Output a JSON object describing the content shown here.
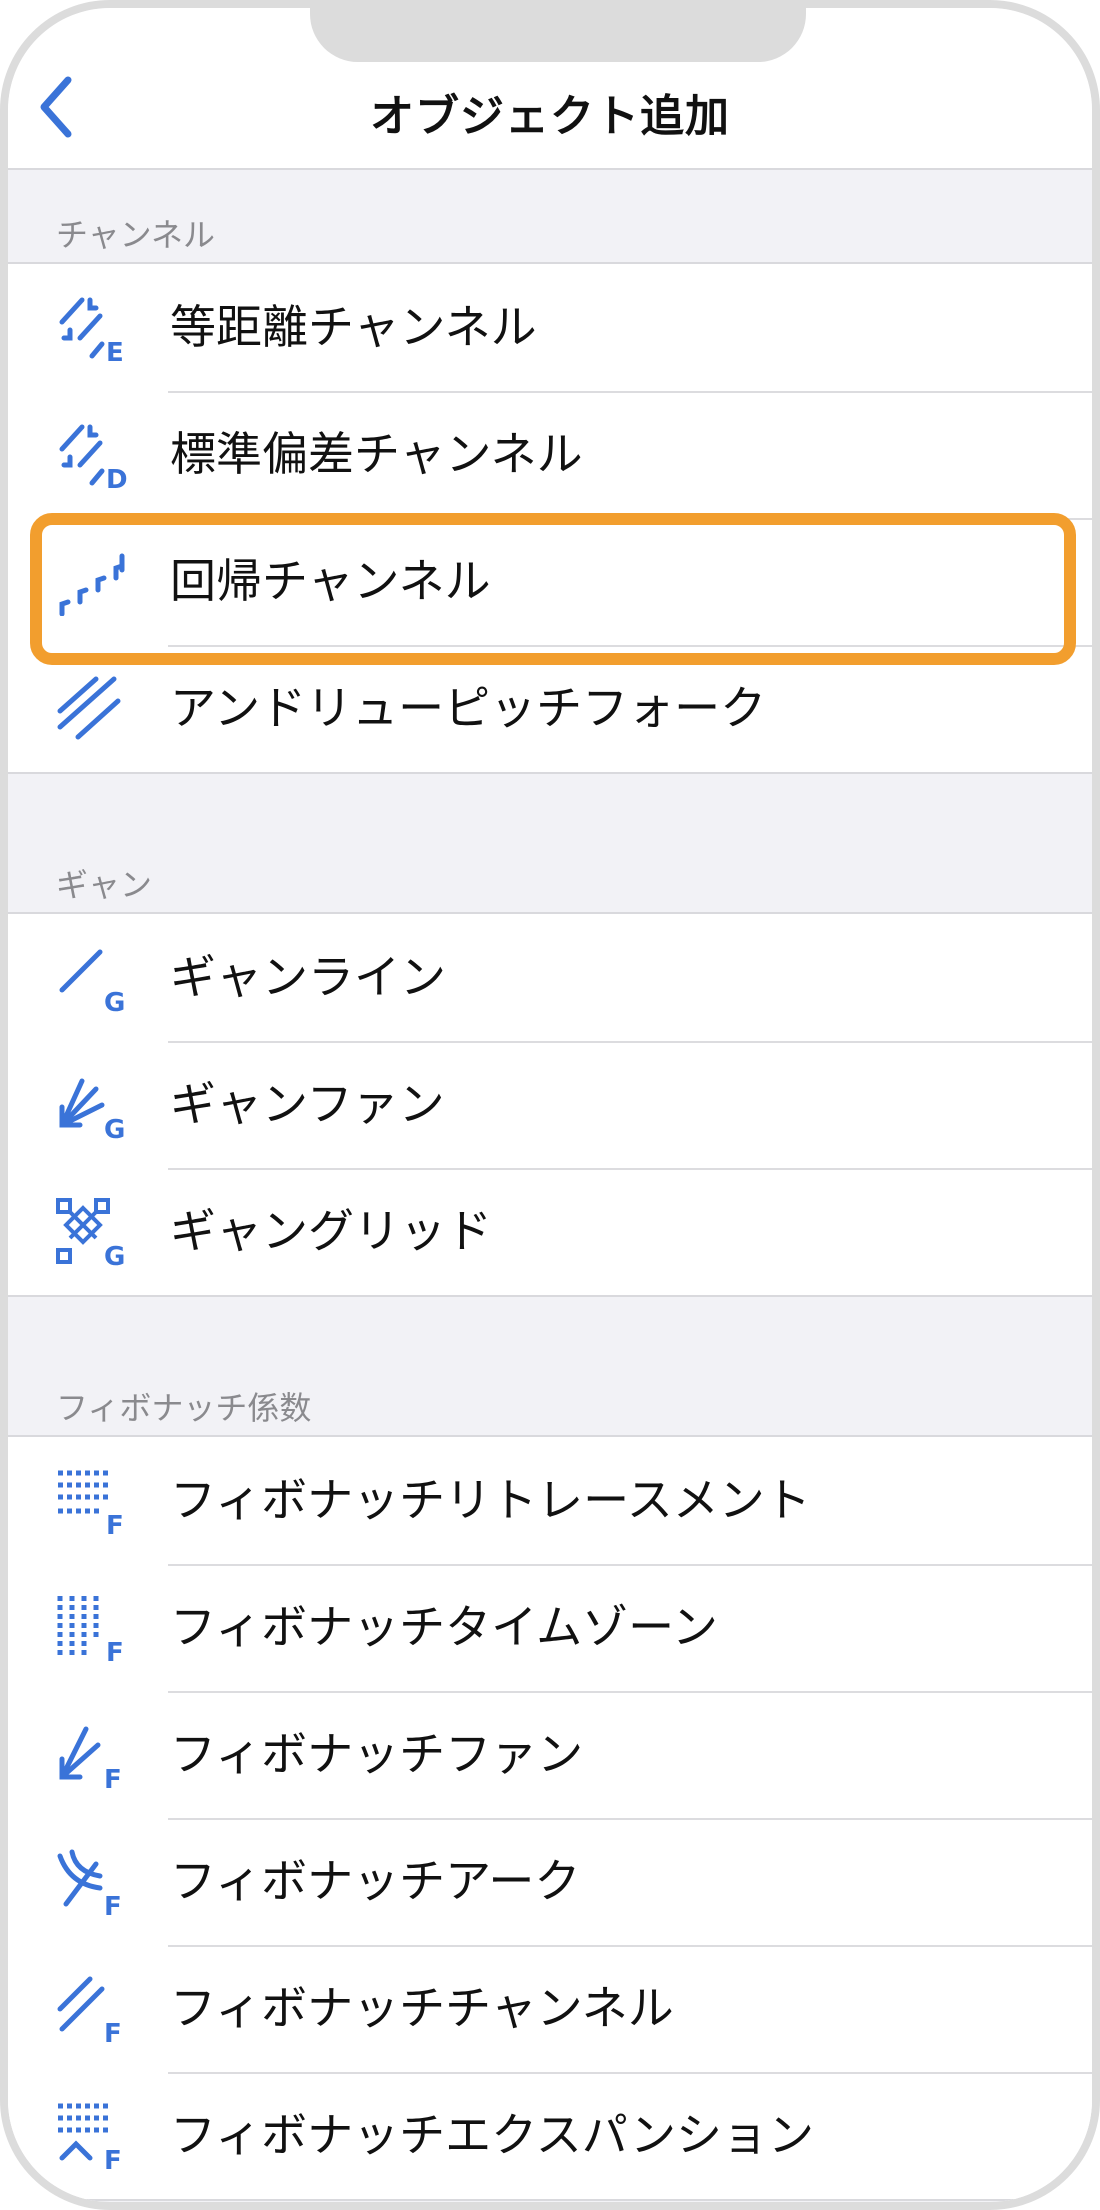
{
  "nav": {
    "title": "オブジェクト追加"
  },
  "sections": [
    {
      "header": "チャンネル",
      "items": [
        {
          "label": "等距離チャンネル",
          "icon": "equidistant-channel-icon"
        },
        {
          "label": "標準偏差チャンネル",
          "icon": "std-deviation-channel-icon"
        },
        {
          "label": "回帰チャンネル",
          "icon": "regression-channel-icon"
        },
        {
          "label": "アンドリューピッチフォーク",
          "icon": "andrews-pitchfork-icon"
        }
      ]
    },
    {
      "header": "ギャン",
      "items": [
        {
          "label": "ギャンライン",
          "icon": "gann-line-icon"
        },
        {
          "label": "ギャンファン",
          "icon": "gann-fan-icon"
        },
        {
          "label": "ギャングリッド",
          "icon": "gann-grid-icon"
        }
      ]
    },
    {
      "header": "フィボナッチ係数",
      "items": [
        {
          "label": "フィボナッチリトレースメント",
          "icon": "fibo-retracement-icon"
        },
        {
          "label": "フィボナッチタイムゾーン",
          "icon": "fibo-timezones-icon"
        },
        {
          "label": "フィボナッチファン",
          "icon": "fibo-fan-icon"
        },
        {
          "label": "フィボナッチアーク",
          "icon": "fibo-arc-icon"
        },
        {
          "label": "フィボナッチチャンネル",
          "icon": "fibo-channel-icon"
        },
        {
          "label": "フィボナッチエクスパンション",
          "icon": "fibo-expansion-icon"
        }
      ]
    }
  ],
  "highlight": {
    "item": "回帰チャンネル",
    "color": "#f29e2e"
  },
  "colors": {
    "accent": "#3a73d8",
    "separator": "#d9d9dd",
    "background": "#f2f2f6"
  }
}
